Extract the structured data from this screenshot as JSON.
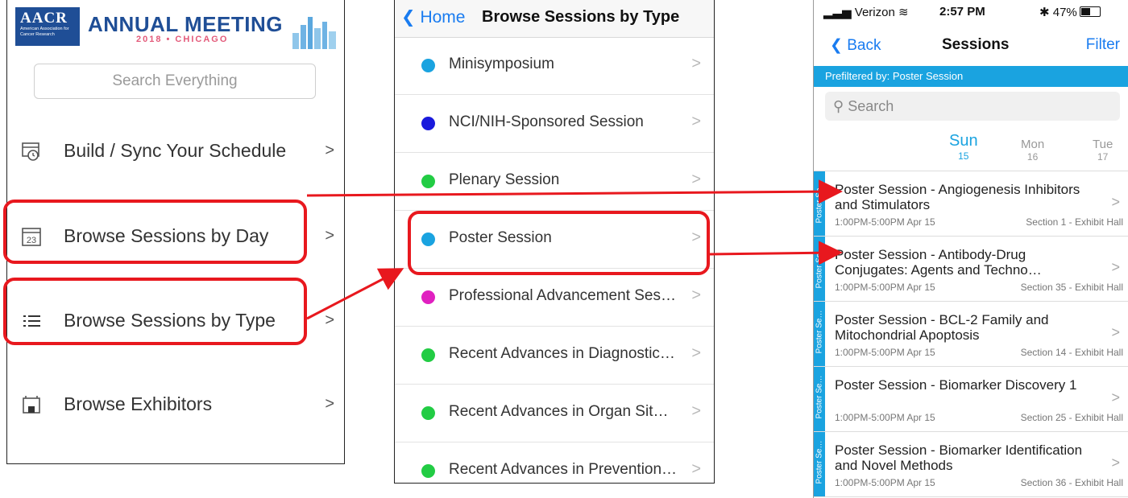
{
  "home": {
    "banner": {
      "logo_text": "AACR",
      "logo_subtext": "American Association for Cancer Research",
      "title": "ANNUAL MEETING",
      "subtitle": "2018 • CHICAGO"
    },
    "search_placeholder": "Search Everything",
    "menu_items": [
      {
        "label": "Build / Sync Your Schedule",
        "icon": "schedule-sync-icon"
      },
      {
        "label": "Browse Sessions by Day",
        "icon": "calendar-icon",
        "icon_text": "23"
      },
      {
        "label": "Browse Sessions by Type",
        "icon": "list-icon"
      },
      {
        "label": "Browse Exhibitors",
        "icon": "exhibitor-booth-icon"
      }
    ],
    "chevron": ">"
  },
  "types": {
    "back_label": "Home",
    "title": "Browse Sessions by Type",
    "items": [
      {
        "label": "Minisymposium",
        "color": "#1aa3e0"
      },
      {
        "label": "NCI/NIH-Sponsored Session",
        "color": "#1a1adc"
      },
      {
        "label": "Plenary Session",
        "color": "#22cc44"
      },
      {
        "label": "Poster Session",
        "color": "#1aa3e0"
      },
      {
        "label": "Professional Advancement Ses…",
        "color": "#e020c0"
      },
      {
        "label": "Recent Advances in Diagnostic…",
        "color": "#22cc44"
      },
      {
        "label": "Recent Advances in Organ Sit…",
        "color": "#22cc44"
      },
      {
        "label": "Recent Advances in Prevention…",
        "color": "#22cc44"
      }
    ]
  },
  "sessions": {
    "status": {
      "carrier": "Verizon",
      "time": "2:57 PM",
      "battery": "47%"
    },
    "back_label": "Back",
    "title": "Sessions",
    "filter_label": "Filter",
    "prefilter": "Prefiltered by: Poster Session",
    "search_placeholder": "Search",
    "days": [
      {
        "name": "Sun",
        "num": "15",
        "active": true
      },
      {
        "name": "Mon",
        "num": "16",
        "active": false
      },
      {
        "name": "Tue",
        "num": "17",
        "active": false
      }
    ],
    "items": [
      {
        "tab": "Poster Se…",
        "title": "Poster Session - Angiogenesis Inhibitors and Stimulators",
        "time": "1:00PM-5:00PM  Apr 15",
        "location": "Section 1 - Exhibit Hall"
      },
      {
        "tab": "Poster Se…",
        "title": "Poster Session - Antibody-Drug Conjugates: Agents and Techno…",
        "time": "1:00PM-5:00PM  Apr 15",
        "location": "Section 35 - Exhibit Hall"
      },
      {
        "tab": "Poster Se…",
        "title": "Poster Session - BCL-2 Family and Mitochondrial Apoptosis",
        "time": "1:00PM-5:00PM  Apr 15",
        "location": "Section 14 - Exhibit Hall"
      },
      {
        "tab": "Poster Se…",
        "title": "Poster Session - Biomarker Discovery 1",
        "time": "1:00PM-5:00PM  Apr 15",
        "location": "Section 25 - Exhibit Hall"
      },
      {
        "tab": "Poster Se…",
        "title": "Poster Session - Biomarker Identification and Novel Methods",
        "time": "1:00PM-5:00PM  Apr 15",
        "location": "Section 36 - Exhibit Hall"
      }
    ]
  },
  "colors": {
    "accent_blue": "#1a7cf0",
    "tab_blue": "#1aa3e0",
    "highlight_red": "#e8181e",
    "brand_navy": "#1f4e96"
  }
}
